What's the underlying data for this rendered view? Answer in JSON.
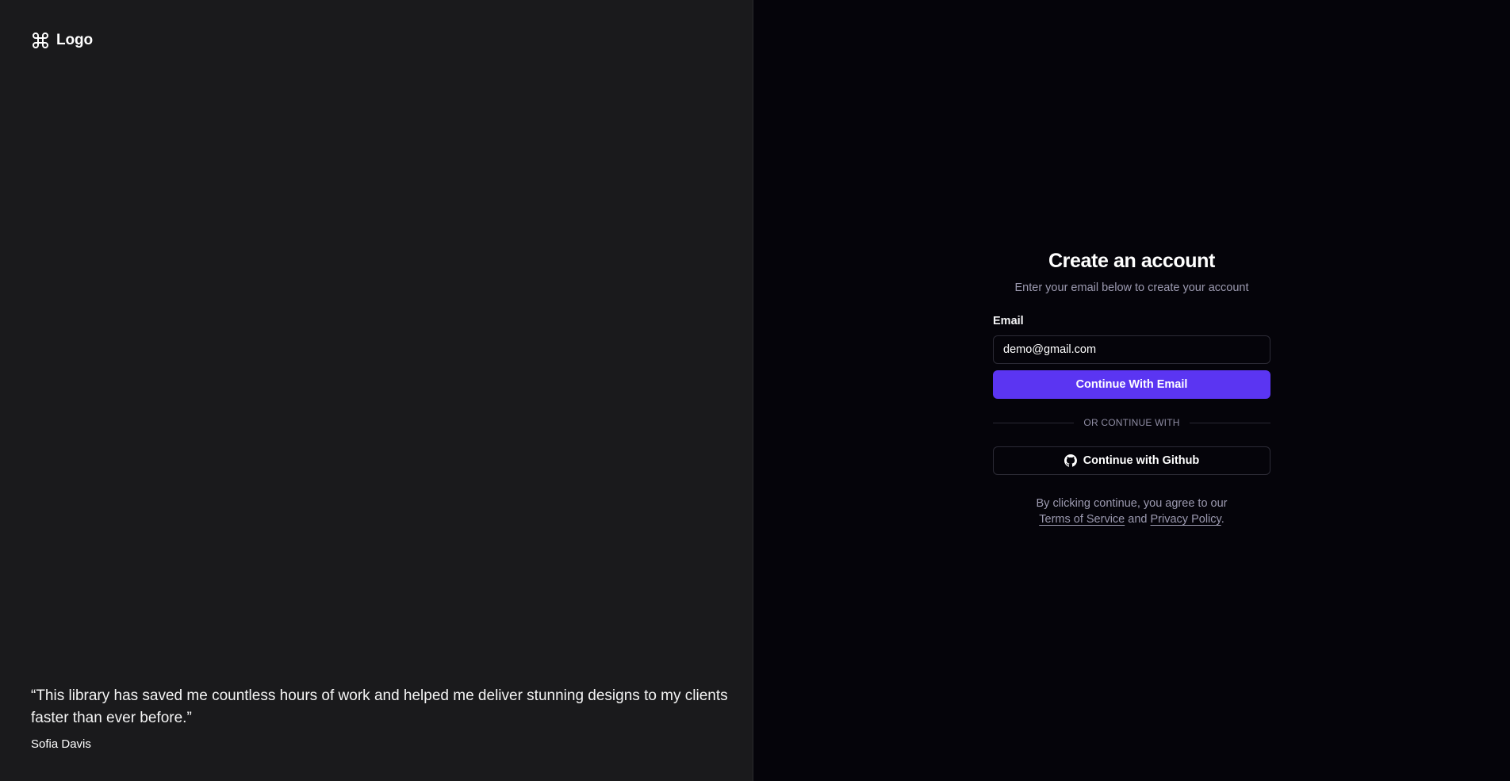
{
  "brand": {
    "logo_text": "Logo",
    "icon": "command-icon"
  },
  "testimonial": {
    "quote": "“This library has saved me countless hours of work and helped me deliver stunning designs to my clients faster than ever before.”",
    "author": "Sofia Davis"
  },
  "signup": {
    "title": "Create an account",
    "subtitle": "Enter your email below to create your account",
    "email_label": "Email",
    "email_value": "demo@gmail.com",
    "primary_button": "Continue With Email",
    "divider_text": "Or continue with",
    "github_button": "Continue with Github",
    "github_icon": "github-icon",
    "terms_prefix": "By clicking continue, you agree to our",
    "terms_link": "Terms of Service",
    "terms_and": "and",
    "privacy_link": "Privacy Policy",
    "terms_suffix": "."
  },
  "colors": {
    "left_bg": "#1a1a1c",
    "right_bg": "#05040a",
    "accent": "#5b35f2",
    "muted_text": "#9c9ab0"
  }
}
